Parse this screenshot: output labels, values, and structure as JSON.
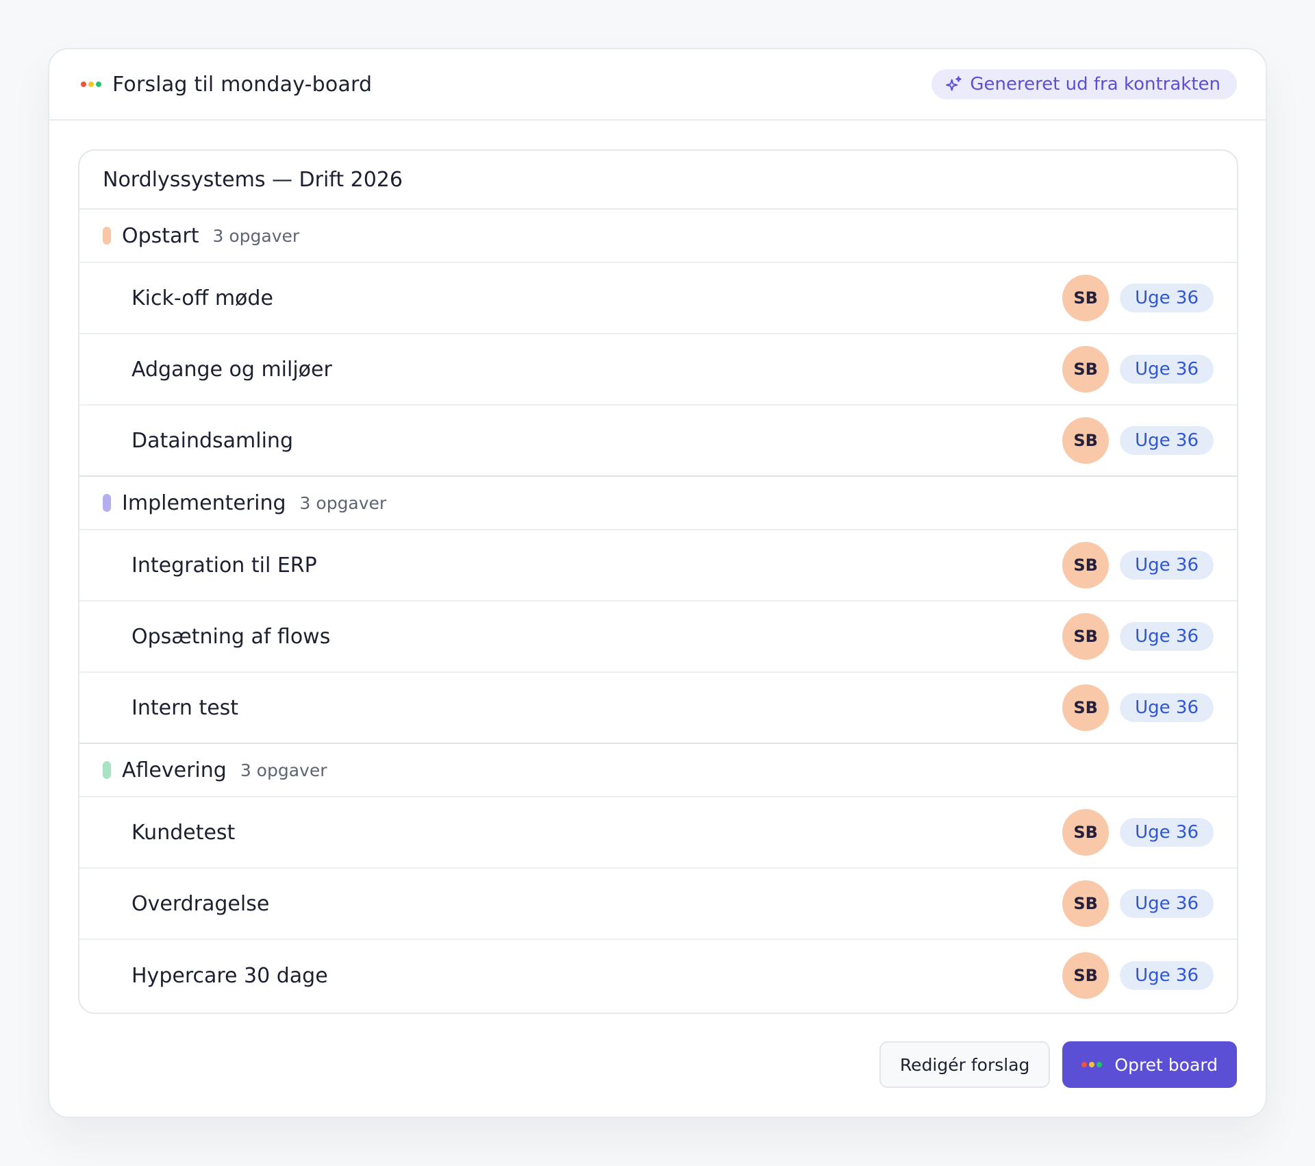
{
  "header": {
    "title": "Forslag til monday-board",
    "badge": "Genereret ud fra kontrakten",
    "logo_colors": [
      "#f0533c",
      "#f5c22d",
      "#22c36e"
    ]
  },
  "board": {
    "title": "Nordlyssystems — Drift 2026",
    "groups": [
      {
        "name": "Opstart",
        "count": "3 opgaver",
        "color": "#f8c8a6",
        "tasks": [
          {
            "name": "Kick-off møde",
            "owner": "SB",
            "week": "Uge 36"
          },
          {
            "name": "Adgange og miljøer",
            "owner": "SB",
            "week": "Uge 36"
          },
          {
            "name": "Dataindsamling",
            "owner": "SB",
            "week": "Uge 36"
          }
        ]
      },
      {
        "name": "Implementering",
        "count": "3 opgaver",
        "color": "#b3aef0",
        "tasks": [
          {
            "name": "Integration til ERP",
            "owner": "SB",
            "week": "Uge 36"
          },
          {
            "name": "Opsætning af flows",
            "owner": "SB",
            "week": "Uge 36"
          },
          {
            "name": "Intern test",
            "owner": "SB",
            "week": "Uge 36"
          }
        ]
      },
      {
        "name": "Aflevering",
        "count": "3 opgaver",
        "color": "#a8e3c3",
        "tasks": [
          {
            "name": "Kundetest",
            "owner": "SB",
            "week": "Uge 36"
          },
          {
            "name": "Overdragelse",
            "owner": "SB",
            "week": "Uge 36"
          },
          {
            "name": "Hypercare 30 dage",
            "owner": "SB",
            "week": "Uge 36"
          }
        ]
      }
    ]
  },
  "actions": {
    "edit_label": "Redigér forslag",
    "create_label": "Opret board"
  }
}
